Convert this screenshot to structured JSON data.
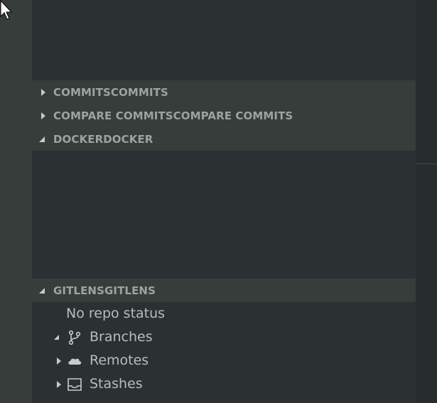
{
  "sections": {
    "commits": {
      "title": "COMMITSCOMMITS",
      "expanded": false
    },
    "compare": {
      "title": "COMPARE COMMITSCOMPARE COMMITS",
      "expanded": false
    },
    "docker": {
      "title": "DOCKERDOCKER",
      "expanded": true
    },
    "gitlens": {
      "title": "GITLENSGITLENS",
      "expanded": true
    }
  },
  "gitlens": {
    "status": "No repo status",
    "items": [
      {
        "label": "Branches",
        "icon": "git-branch-icon",
        "expanded": true
      },
      {
        "label": "Remotes",
        "icon": "cloud-icon",
        "expanded": false
      },
      {
        "label": "Stashes",
        "icon": "inbox-icon",
        "expanded": false
      }
    ]
  },
  "colors": {
    "background": "#2b3033",
    "header_background": "#373d3a",
    "header_text": "#9ea3a0",
    "tree_text": "#b9bcba"
  }
}
